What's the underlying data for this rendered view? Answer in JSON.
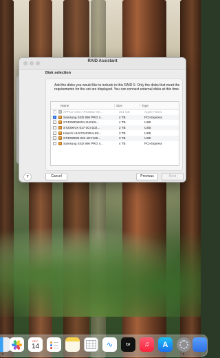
{
  "window": {
    "title": "RAID Assistant",
    "section_title": "Disk selection",
    "description": "Add the disks you would like to include in this RAID 0. Only the disks that meet the requirements for the set are displayed. You can connect external disks at this time."
  },
  "table": {
    "columns": {
      "name": "Name",
      "size": "Size",
      "type": "Type"
    },
    "rows": [
      {
        "name": "APPLE SSD AP0256Z Me...",
        "size": "251 GB",
        "type": "Apple Fabric",
        "checked": false,
        "disabled": true
      },
      {
        "name": "Samsung SSD 990 PRO 4...",
        "size": "4 TB",
        "type": "PCI-Express",
        "checked": true,
        "disabled": false
      },
      {
        "name": "ST4000DM004-2U9104...",
        "size": "4 TB",
        "type": "USB",
        "checked": false,
        "disabled": false
      },
      {
        "name": "ST2000VX 017-3CV102...",
        "size": "2 TB",
        "type": "USB",
        "checked": false,
        "disabled": false
      },
      {
        "name": "Hitachi HUS724030ALE6...",
        "size": "3 TB",
        "type": "USB",
        "checked": false,
        "disabled": false
      },
      {
        "name": "ST3000DM 001-1DY166...",
        "size": "3 TB",
        "type": "USB",
        "checked": false,
        "disabled": false
      },
      {
        "name": "Samsung SSD 990 PRO 4...",
        "size": "4 TB",
        "type": "PCI-Express",
        "checked": false,
        "disabled": false
      }
    ]
  },
  "buttons": {
    "help": "?",
    "cancel": "Cancel",
    "previous": "Previous",
    "next": "Next"
  },
  "dock": {
    "calendar_month": "DEC",
    "calendar_day": "14",
    "tv_label": "tv",
    "apps": [
      "finder-icon",
      "photos-icon",
      "calendar-icon",
      "reminders-icon",
      "notes-icon",
      "numbers-icon",
      "freeform-icon",
      "apple-tv-icon",
      "music-icon",
      "app-store-icon",
      "system-settings-icon"
    ]
  },
  "colors": {
    "accent": "#2f6fe0",
    "disk_icon": "#f2b64a"
  }
}
